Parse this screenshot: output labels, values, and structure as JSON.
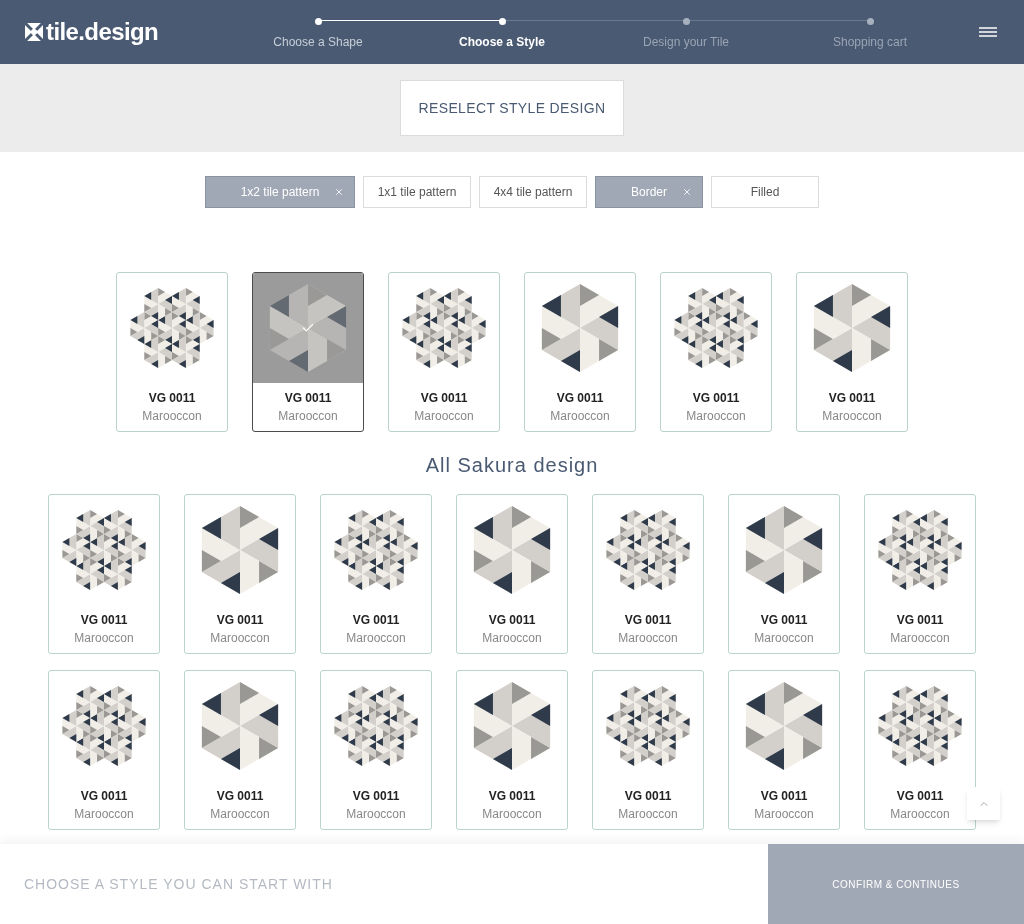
{
  "header": {
    "logo": "tile.design",
    "steps": [
      {
        "label": "Choose a Shape",
        "done": true,
        "selected": false
      },
      {
        "label": "Choose a Style",
        "done": true,
        "selected": true
      },
      {
        "label": "Design your Tile",
        "done": false,
        "selected": false
      },
      {
        "label": "Shopping cart",
        "done": false,
        "selected": false
      }
    ]
  },
  "reselect_button": "RESELECT STYLE DESIGN",
  "filters": [
    {
      "label": "1x2 tile pattern",
      "selected": true
    },
    {
      "label": "1x1 tile pattern",
      "selected": false
    },
    {
      "label": "4x4 tile pattern",
      "selected": false
    },
    {
      "label": "Border",
      "selected": true
    },
    {
      "label": "Filled",
      "selected": false
    }
  ],
  "featured": [
    {
      "kind": "cluster",
      "code": "VG 0011",
      "name": "Marooccon",
      "selected": false
    },
    {
      "kind": "star",
      "code": "VG 0011",
      "name": "Marooccon",
      "selected": true
    },
    {
      "kind": "cluster",
      "code": "VG 0011",
      "name": "Marooccon",
      "selected": false
    },
    {
      "kind": "star",
      "code": "VG 0011",
      "name": "Marooccon",
      "selected": false
    },
    {
      "kind": "cluster",
      "code": "VG 0011",
      "name": "Marooccon",
      "selected": false
    },
    {
      "kind": "star",
      "code": "VG 0011",
      "name": "Marooccon",
      "selected": false
    }
  ],
  "section_title": "All Sakura design",
  "designs": [
    {
      "kind": "cluster",
      "code": "VG 0011",
      "name": "Marooccon"
    },
    {
      "kind": "star",
      "code": "VG 0011",
      "name": "Marooccon"
    },
    {
      "kind": "cluster",
      "code": "VG 0011",
      "name": "Marooccon"
    },
    {
      "kind": "star",
      "code": "VG 0011",
      "name": "Marooccon"
    },
    {
      "kind": "cluster",
      "code": "VG 0011",
      "name": "Marooccon"
    },
    {
      "kind": "star",
      "code": "VG 0011",
      "name": "Marooccon"
    },
    {
      "kind": "cluster",
      "code": "VG 0011",
      "name": "Marooccon"
    },
    {
      "kind": "cluster",
      "code": "VG 0011",
      "name": "Marooccon"
    },
    {
      "kind": "star",
      "code": "VG 0011",
      "name": "Marooccon"
    },
    {
      "kind": "cluster",
      "code": "VG 0011",
      "name": "Marooccon"
    },
    {
      "kind": "star",
      "code": "VG 0011",
      "name": "Marooccon"
    },
    {
      "kind": "cluster",
      "code": "VG 0011",
      "name": "Marooccon"
    },
    {
      "kind": "star",
      "code": "VG 0011",
      "name": "Marooccon"
    },
    {
      "kind": "cluster",
      "code": "VG 0011",
      "name": "Marooccon"
    }
  ],
  "footer": {
    "prompt": "CHOOSE A STYLE YOU CAN START WITH",
    "confirm_button": "CONFIRM & CONTINUES"
  }
}
